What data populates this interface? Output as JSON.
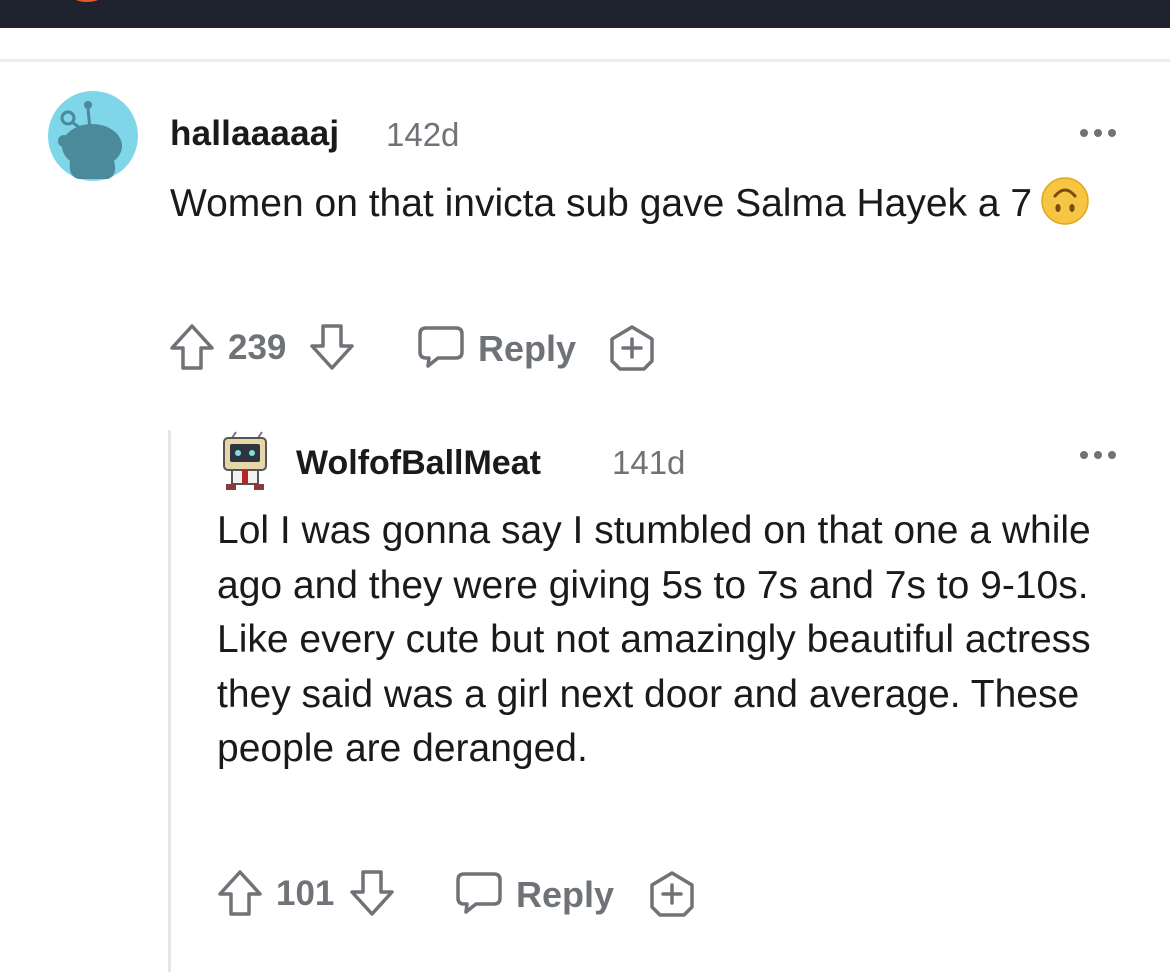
{
  "comment": {
    "author": "hallaaaaaj",
    "age": "142d",
    "body_text": "Women on that invicta sub gave Salma Hayek a 7",
    "emoji": "upside-down-face-emoji",
    "upvotes": "239",
    "reply_label": "Reply"
  },
  "reply": {
    "author": "WolfofBallMeat",
    "age": "141d",
    "body_text": "Lol I was gonna say I stumbled on that one a while ago and they were giving 5s to 7s and 7s to 9-10s. Like every cute but not amazingly beautiful actress they said was a girl next door and average. These people are deranged.",
    "upvotes": "101",
    "reply_label": "Reply"
  },
  "colors": {
    "top_bar": "#1f2330",
    "avatar_bg": "#7fd6e8",
    "snoo": "#4a8a9a",
    "meta_text": "#6f7377",
    "emoji_yellow": "#f7c544",
    "thread_line": "#e6e6e6"
  },
  "icons": [
    "upvote-icon",
    "downvote-icon",
    "comment-bubble-icon",
    "award-icon",
    "more-options-icon"
  ]
}
